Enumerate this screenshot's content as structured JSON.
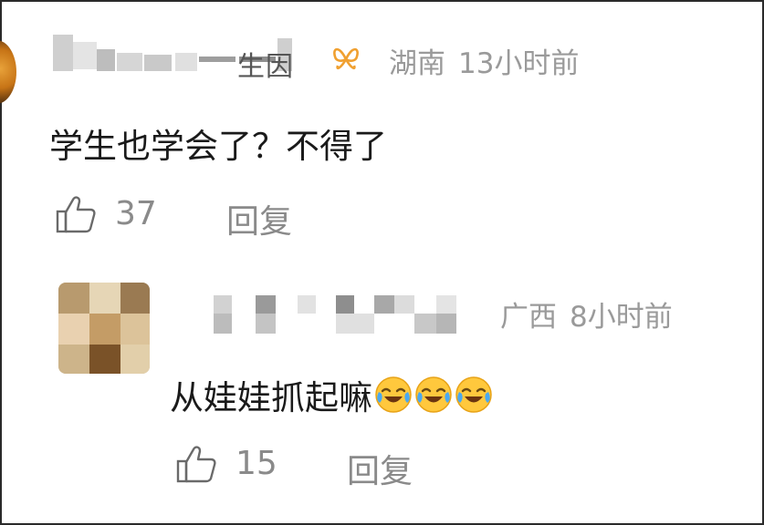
{
  "comments": [
    {
      "username_visible": "生因",
      "location": "湖南",
      "time": "13小时前",
      "text": "学生也学会了？不得了",
      "likes": "37",
      "reply_label": "回复",
      "badge_icon": "vip-butterfly-icon"
    },
    {
      "location": "广西",
      "time": "8小时前",
      "text": "从娃娃抓起嘛",
      "emoji_icon": "laugh-cry-emoji",
      "emoji_count": 3,
      "likes": "15",
      "reply_label": "回复"
    }
  ],
  "colors": {
    "text": "#1a1a1a",
    "meta": "#9a9a9a",
    "action": "#8a8a8a",
    "badge": "#f0a030"
  }
}
